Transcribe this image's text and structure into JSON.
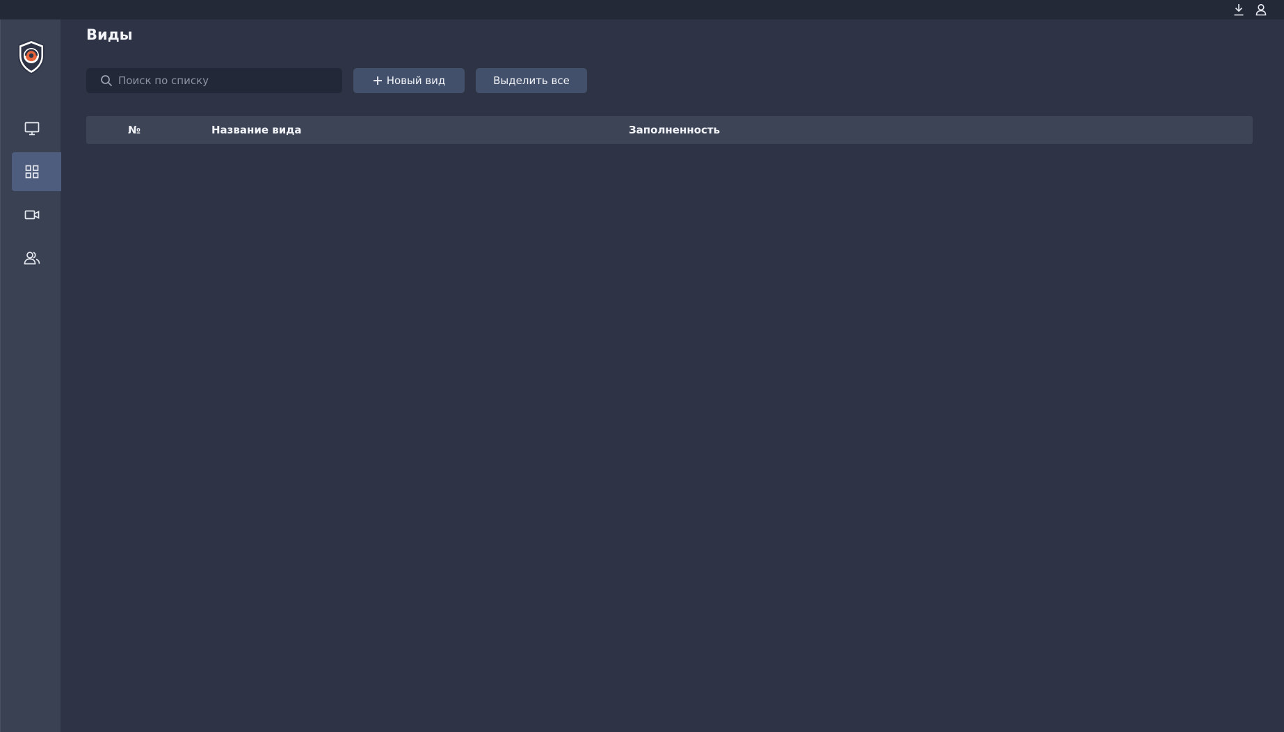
{
  "topbar": {
    "icons": [
      "download-icon",
      "user-icon"
    ]
  },
  "sidebar": {
    "items": [
      {
        "icon": "monitor-icon",
        "active": false
      },
      {
        "icon": "grid-icon",
        "active": true
      },
      {
        "icon": "camera-icon",
        "active": false
      },
      {
        "icon": "users-icon",
        "active": false
      }
    ]
  },
  "page": {
    "title": "Виды"
  },
  "toolbar": {
    "search_placeholder": "Поиск по списку",
    "new_view_label": "Новый вид",
    "select_all_label": "Выделить все"
  },
  "table": {
    "columns": [
      "№",
      "Название вида",
      "Заполненность"
    ],
    "rows": []
  },
  "colors": {
    "background": "#2e3445",
    "topbar": "#232937",
    "sidebar": "#3a4152",
    "active_nav": "#4e5c7e",
    "button": "#43506c",
    "accent_logo": "#e8643c"
  }
}
